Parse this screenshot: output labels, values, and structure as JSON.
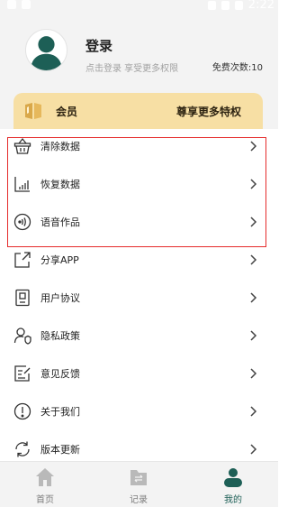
{
  "status_bar": {
    "time": "2:22"
  },
  "profile": {
    "title": "登录",
    "subtitle": "点击登录 享受更多权限",
    "free_count": "免费次数:10"
  },
  "vip": {
    "label": "会员",
    "right_text": "尊享更多特权"
  },
  "menu": {
    "items": [
      {
        "label": "清除数据",
        "icon": "basket-icon"
      },
      {
        "label": "恢复数据",
        "icon": "signal-bars-icon"
      },
      {
        "label": "语音作品",
        "icon": "sound-wave-icon"
      },
      {
        "label": "分享APP",
        "icon": "share-icon"
      },
      {
        "label": "用户协议",
        "icon": "document-icon"
      },
      {
        "label": "隐私政策",
        "icon": "user-shield-icon"
      },
      {
        "label": "意见反馈",
        "icon": "feedback-icon"
      },
      {
        "label": "关于我们",
        "icon": "info-icon"
      },
      {
        "label": "版本更新",
        "icon": "refresh-icon"
      }
    ]
  },
  "tabs": [
    {
      "label": "首页",
      "icon": "home-icon"
    },
    {
      "label": "记录",
      "icon": "folder-icon"
    },
    {
      "label": "我的",
      "icon": "person-icon",
      "active": true
    }
  ],
  "colors": {
    "accent": "#1d5f56",
    "vip_background": "#f7dfa4",
    "highlight_border": "#e52b2b",
    "header_background": "#f3f3f3"
  }
}
